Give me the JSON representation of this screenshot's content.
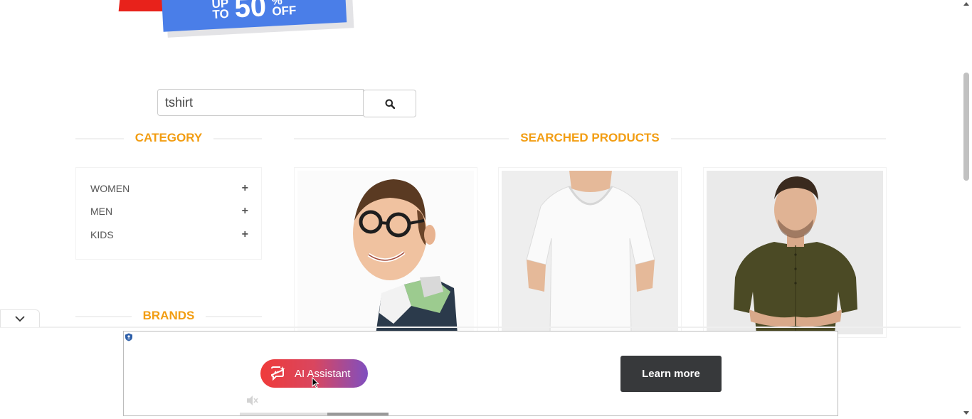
{
  "banner": {
    "upto_line1": "UP",
    "upto_line2": "TO",
    "number": "50",
    "percent": "%",
    "off": "OFF"
  },
  "search": {
    "value": "tshirt",
    "button_icon": "search-icon"
  },
  "category": {
    "title": "CATEGORY",
    "items": [
      {
        "label": "WOMEN",
        "icon": "+"
      },
      {
        "label": "MEN",
        "icon": "+"
      },
      {
        "label": "KIDS",
        "icon": "+"
      }
    ]
  },
  "brands": {
    "title": "BRANDS"
  },
  "products": {
    "title": "SEARCHED PRODUCTS",
    "items": [
      {
        "image": "man-with-glasses-striped-shirt"
      },
      {
        "image": "white-v-neck-tshirt"
      },
      {
        "image": "olive-henley-shirt"
      }
    ]
  },
  "ad": {
    "ai_button_label": "AI Assistant",
    "learn_more_label": "Learn more",
    "progress": 0.41,
    "progress_played": 0.59
  },
  "colors": {
    "accent": "#f29d12",
    "ad_gradient_start": "#ef3b3a",
    "ad_gradient_end": "#7f4fc0",
    "learn_more_bg": "#37393b"
  }
}
